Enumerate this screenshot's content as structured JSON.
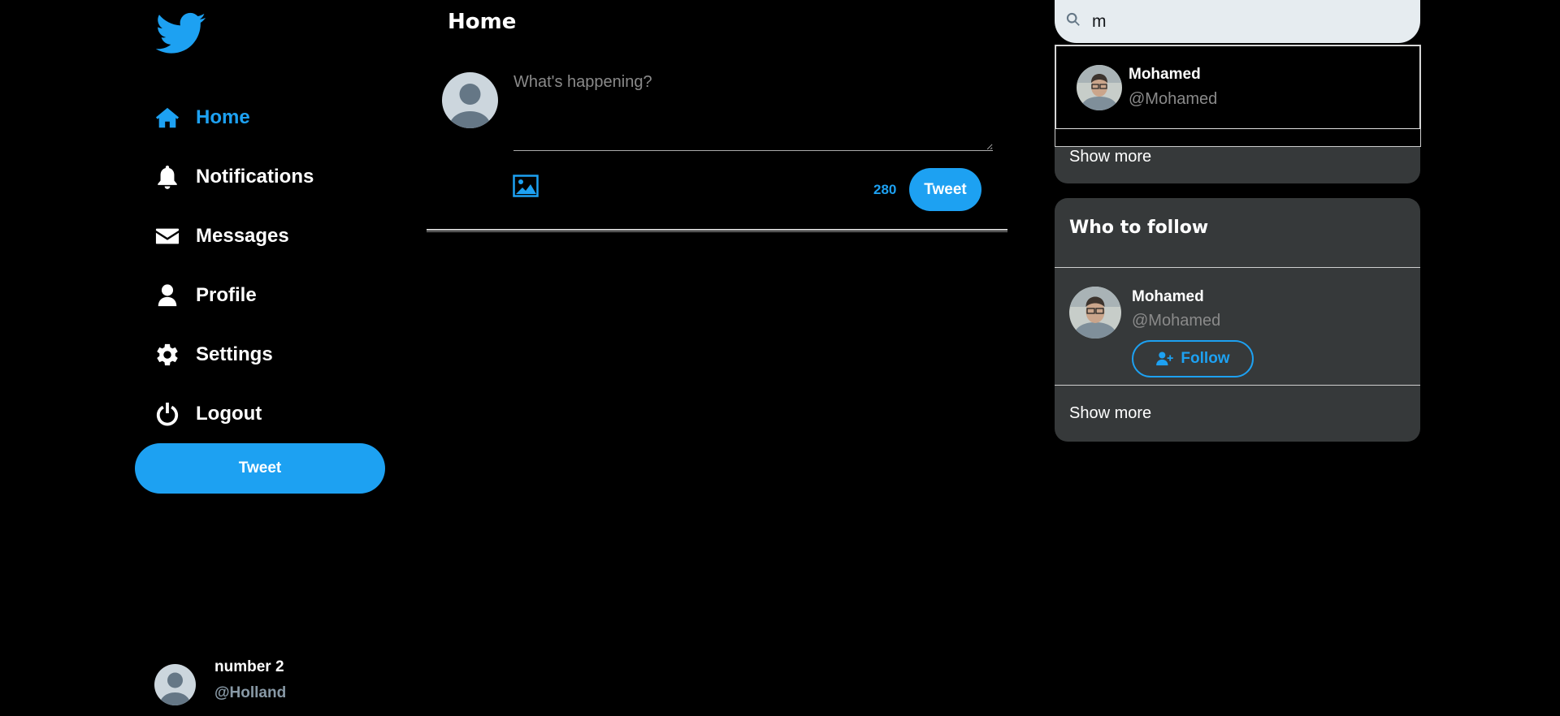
{
  "sidebar": {
    "logo": "twitter-bird-icon",
    "nav": [
      {
        "label": "Home",
        "icon": "home-icon",
        "active": true
      },
      {
        "label": "Notifications",
        "icon": "bell-icon"
      },
      {
        "label": "Messages",
        "icon": "envelope-icon"
      },
      {
        "label": "Profile",
        "icon": "user-icon"
      },
      {
        "label": "Settings",
        "icon": "gear-icon"
      },
      {
        "label": "Logout",
        "icon": "power-icon"
      }
    ],
    "tweet_button": "Tweet",
    "account": {
      "name": "number 2",
      "handle": "@Holland"
    }
  },
  "main": {
    "title": "Home",
    "compose": {
      "placeholder": "What's happening?",
      "char_count": "280",
      "tweet_button": "Tweet"
    }
  },
  "right": {
    "search": {
      "value": "m"
    },
    "search_results": [
      {
        "name": "Mohamed",
        "handle": "@Mohamed"
      }
    ],
    "trends": {
      "show_more": "Show more"
    },
    "who_to_follow": {
      "title": "Who to follow",
      "users": [
        {
          "name": "Mohamed",
          "handle": "@Mohamed",
          "button": "Follow"
        }
      ],
      "show_more": "Show more"
    }
  },
  "colors": {
    "accent": "#1da1f2",
    "background": "#000000",
    "panel": "#36393a",
    "search_bg": "#e6ecf0",
    "muted_text": "#8a8a8a"
  }
}
